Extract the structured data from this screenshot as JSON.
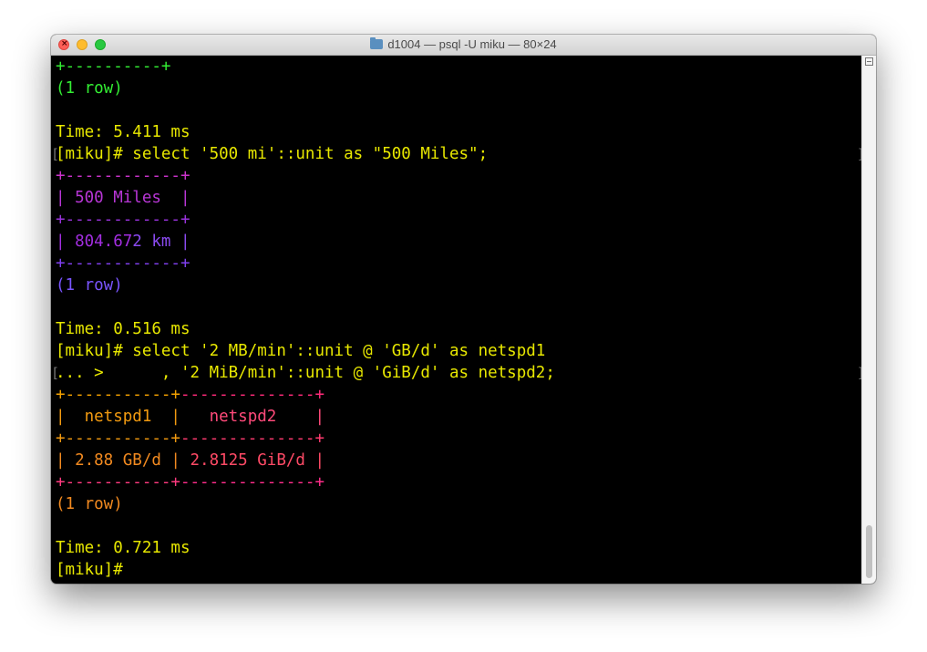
{
  "window": {
    "title": "d1004 — psql -U miku — 80×24",
    "colors": {
      "background": "#000000",
      "prompt": "#e8e800"
    }
  },
  "terminal": {
    "lines": [
      {
        "segs": [
          {
            "t": "+----------+",
            "c": "#33ee33"
          }
        ]
      },
      {
        "segs": [
          {
            "t": "(1 row)",
            "c": "#33ee33"
          }
        ]
      },
      {
        "segs": []
      },
      {
        "segs": [
          {
            "t": "Time: 5.411 ms",
            "c": "#e8e800"
          }
        ]
      },
      {
        "segs": [
          {
            "t": "[miku]# select '500 mi'::unit as \"500 Miles\";",
            "c": "#e8e800"
          }
        ],
        "bracket": true
      },
      {
        "segs": [
          {
            "t": "+------------+",
            "c": "#cc33cc"
          }
        ]
      },
      {
        "segs": [
          {
            "t": "| 500 Miles  |",
            "c": "#b836d6"
          }
        ]
      },
      {
        "segs": [
          {
            "t": "+------------+",
            "c": "#9a33dd"
          }
        ]
      },
      {
        "segs": [
          {
            "t": "| 804.67",
            "c": "#a22ee0"
          },
          {
            "t": "2 km |",
            "c": "#8a4af0"
          }
        ]
      },
      {
        "segs": [
          {
            "t": "+------------+",
            "c": "#8040f0"
          }
        ]
      },
      {
        "segs": [
          {
            "t": "(1 row)",
            "c": "#7a55ff"
          }
        ]
      },
      {
        "segs": []
      },
      {
        "segs": [
          {
            "t": "Time: 0.516 ms",
            "c": "#e8e800"
          }
        ]
      },
      {
        "segs": [
          {
            "t": "[miku]# select '2 MB/min'::unit @ 'GB/d' as netspd1",
            "c": "#e8e800"
          }
        ]
      },
      {
        "segs": [
          {
            "t": "... >      , '2 MiB/min'::unit @ 'GiB/d' as netspd2;",
            "c": "#e8e800"
          }
        ],
        "bracket": true
      },
      {
        "segs": [
          {
            "t": "+-----------+",
            "c": "#f2a000"
          },
          {
            "t": "--------------+",
            "c": "#ff2b7a"
          }
        ]
      },
      {
        "segs": [
          {
            "t": "|  netspd1  |",
            "c": "#f29a10"
          },
          {
            "t": "   netspd2    |",
            "c": "#ff4a7a"
          }
        ]
      },
      {
        "segs": [
          {
            "t": "+-----------+",
            "c": "#f29a10"
          },
          {
            "t": "--------------+",
            "c": "#ff3b70"
          }
        ]
      },
      {
        "segs": [
          {
            "t": "| 2.88 GB/d |",
            "c": "#f28a20"
          },
          {
            "t": " 2.8125 GiB/d |",
            "c": "#ff4a66"
          }
        ]
      },
      {
        "segs": [
          {
            "t": "+-----------+",
            "c": "#ff3a80"
          },
          {
            "t": "--------------+",
            "c": "#ff2d8a"
          }
        ]
      },
      {
        "segs": [
          {
            "t": "(1 row)",
            "c": "#f28a20"
          }
        ]
      },
      {
        "segs": []
      },
      {
        "segs": [
          {
            "t": "Time: 0.721 ms",
            "c": "#e8e800"
          }
        ]
      },
      {
        "segs": [
          {
            "t": "[miku]# ",
            "c": "#e8e800"
          }
        ],
        "cursor": true
      }
    ]
  }
}
